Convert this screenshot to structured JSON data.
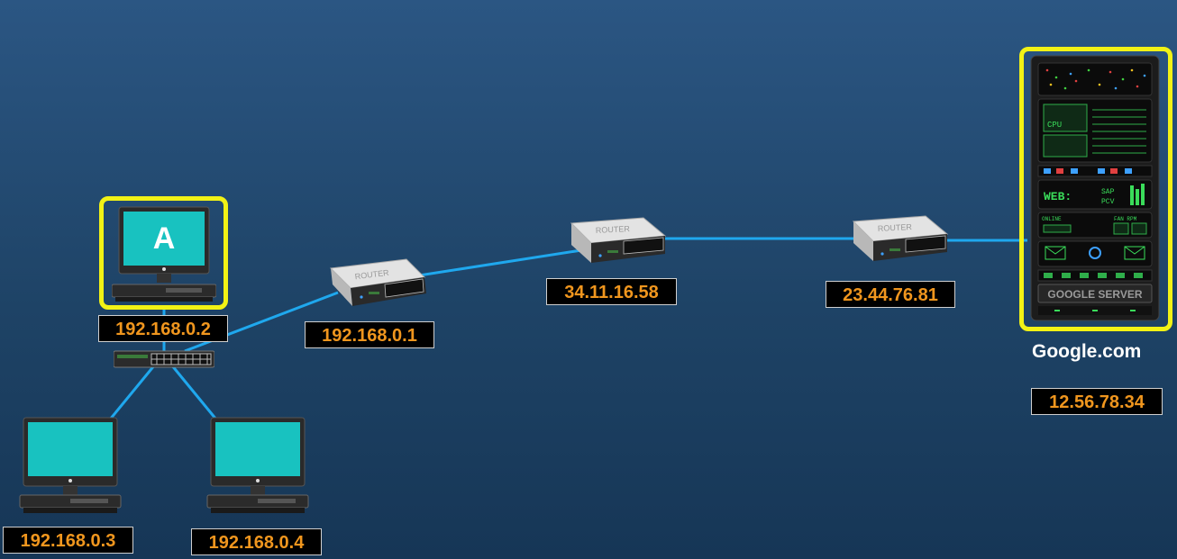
{
  "computers": [
    {
      "ip": "192.168.0.2",
      "label": "A"
    },
    {
      "ip": "192.168.0.3",
      "label": ""
    },
    {
      "ip": "192.168.0.4",
      "label": ""
    }
  ],
  "routers": [
    {
      "ip": "192.168.0.1",
      "label": "ROUTER"
    },
    {
      "ip": "34.11.16.58",
      "label": "ROUTER"
    },
    {
      "ip": "23.44.76.81",
      "label": "ROUTER"
    }
  ],
  "server": {
    "name": "Google.com",
    "ip": "12.56.78.34",
    "panel_label": "GOOGLE SERVER",
    "cpu_label": "CPU",
    "web_label": "WEB:",
    "sap_label": "SAP",
    "pcv_label": "PCV",
    "fan_label": "FAN RPM",
    "online_label": "ONLINE"
  },
  "colors": {
    "link": "#1fa8ee",
    "highlight": "#f2f215",
    "ip_text": "#f0961e",
    "screen": "#19c7c4"
  }
}
